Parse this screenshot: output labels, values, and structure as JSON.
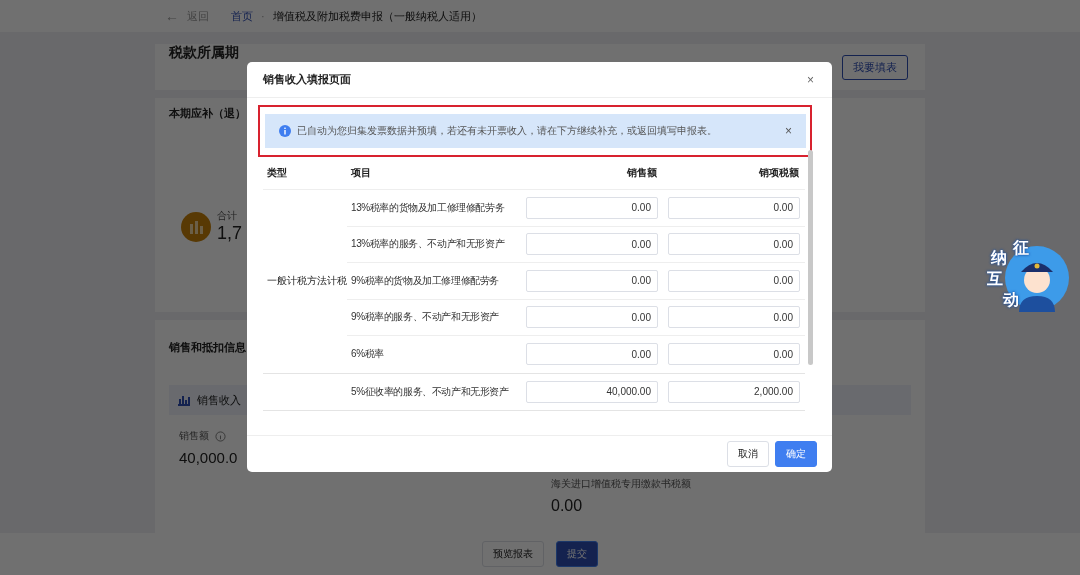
{
  "page": {
    "back_arrow": "←",
    "back": "返回",
    "crumb_separator": "·",
    "breadcrumb": [
      "首页",
      "增值税及附加税费申报（一般纳税人适用）"
    ],
    "period_label": "税款所属期",
    "fill_button": "我要填表",
    "payable_title": "本期应补（退）",
    "total_label": "合计",
    "total_value": "1,7",
    "section_title": "销售和抵扣信息",
    "tab_label": "销售收入",
    "sales_label": "销售额",
    "sales_value": "40,000.0",
    "customs_label": "海关进口增值税专用缴款书税额",
    "customs_value": "0.00",
    "footer_buttons": [
      {
        "label": "预览报表",
        "kind": "default"
      },
      {
        "label": "提交",
        "kind": "primary"
      }
    ]
  },
  "widget": {
    "chars": [
      "征",
      "纳",
      "互",
      "动"
    ]
  },
  "dialog": {
    "title": "销售收入填报页面",
    "close": "×",
    "alert": {
      "text": "已自动为您归集发票数据并预填，若还有未开票收入，请在下方继续补充，或返回填写申报表。",
      "close": "×"
    },
    "columns": [
      "类型",
      "项目",
      "销售额",
      "销项税额"
    ],
    "groups": [
      {
        "type": "一般计税方法计税",
        "rows": [
          {
            "item": "13%税率的货物及加工修理修配劳务",
            "sales": "0.00",
            "tax": "0.00"
          },
          {
            "item": "13%税率的服务、不动产和无形资产",
            "sales": "0.00",
            "tax": "0.00"
          },
          {
            "item": "9%税率的货物及加工修理修配劳务",
            "sales": "0.00",
            "tax": "0.00"
          },
          {
            "item": "9%税率的服务、不动产和无形资产",
            "sales": "0.00",
            "tax": "0.00"
          },
          {
            "item": "6%税率",
            "sales": "0.00",
            "tax": "0.00"
          }
        ]
      },
      {
        "rows": [
          {
            "item": "5%征收率的服务、不动产和无形资产",
            "sales": "40,000.00",
            "tax": "2,000.00"
          }
        ]
      }
    ],
    "buttons": [
      {
        "label": "取消",
        "kind": "default"
      },
      {
        "label": "确定",
        "kind": "primary"
      }
    ]
  }
}
